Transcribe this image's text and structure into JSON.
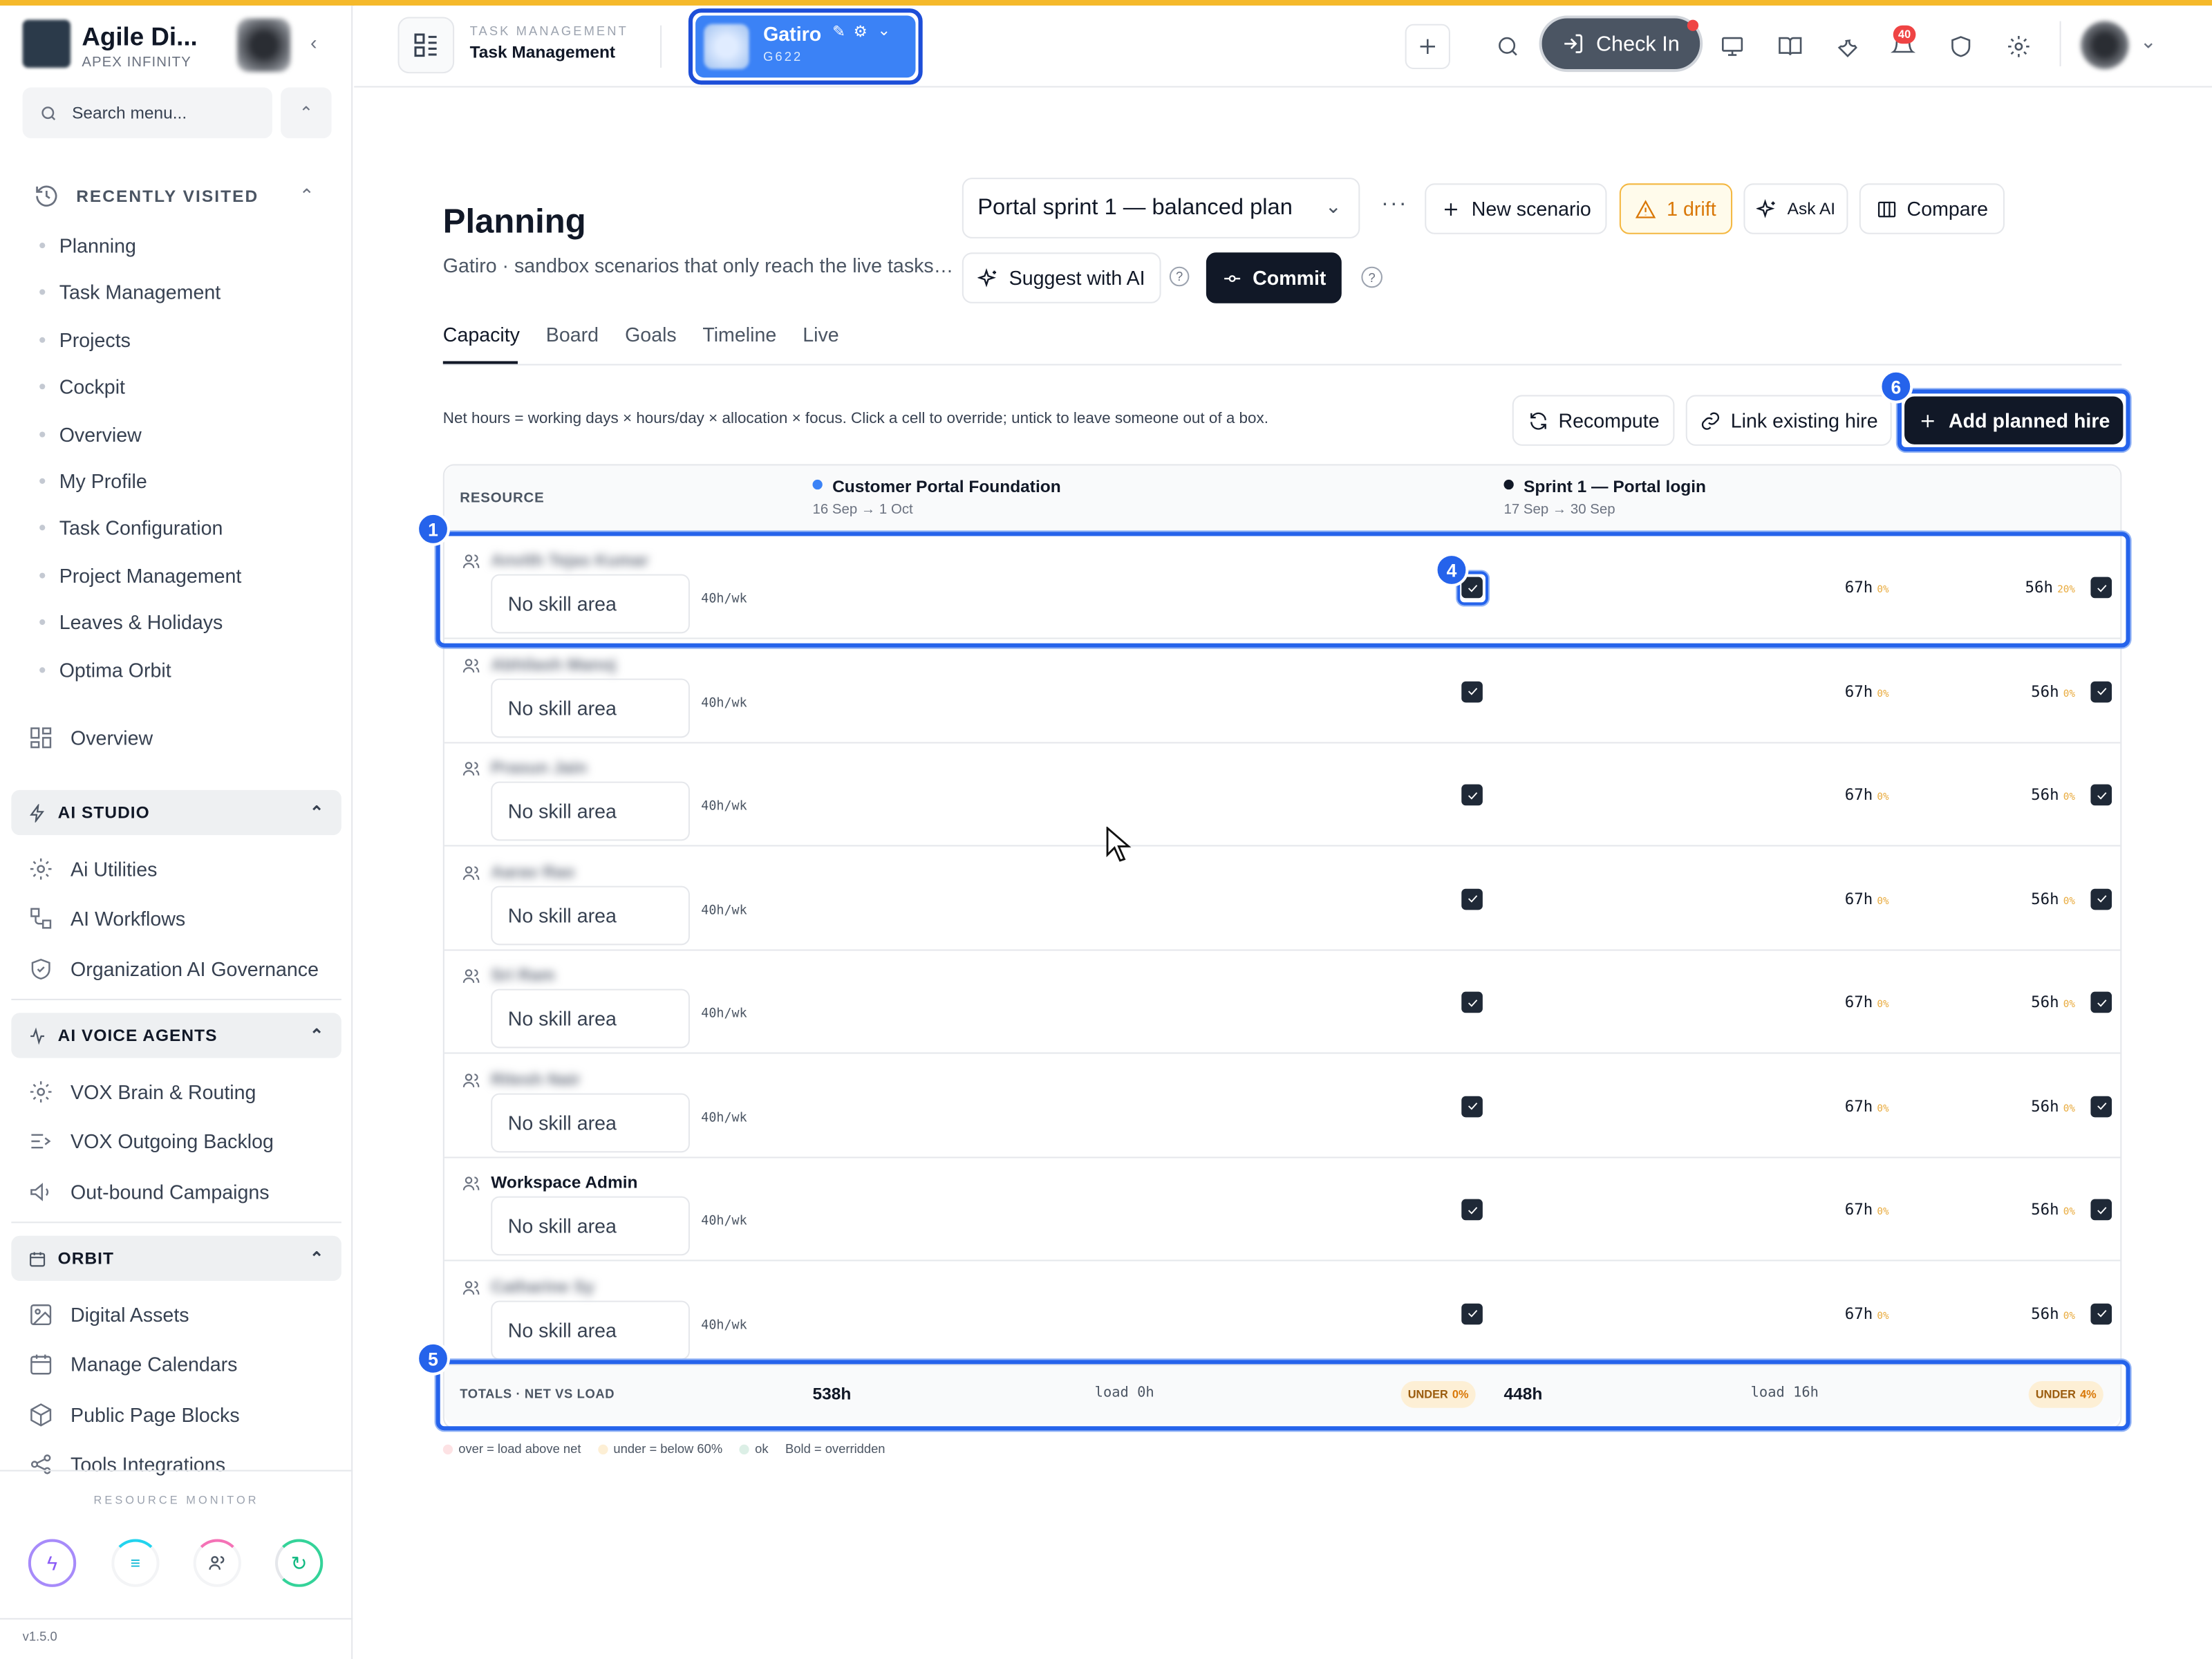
{
  "app": {
    "title": "Agile Di...",
    "org": "APEX INFINITY",
    "version": "v1.5.0"
  },
  "sidebar": {
    "search_placeholder": "Search menu...",
    "recent_label": "RECENTLY VISITED",
    "recent_items": [
      "Planning",
      "Task Management",
      "Projects",
      "Cockpit",
      "Overview",
      "My Profile",
      "Task Configuration",
      "Project Management",
      "Leaves & Holidays",
      "Optima Orbit"
    ],
    "overview_label": "Overview",
    "sections": [
      {
        "label": "AI STUDIO",
        "items": [
          "Ai Utilities",
          "AI Workflows",
          "Organization AI Governance"
        ]
      },
      {
        "label": "AI VOICE AGENTS",
        "items": [
          "VOX Brain & Routing",
          "VOX Outgoing Backlog",
          "Out-bound Campaigns"
        ]
      },
      {
        "label": "ORBIT",
        "items": [
          "Digital Assets",
          "Manage Calendars",
          "Public Page Blocks",
          "Tools Integrations"
        ]
      }
    ],
    "resource_monitor": "RESOURCE MONITOR"
  },
  "header": {
    "module_label": "TASK MANAGEMENT",
    "module_title": "Task Management",
    "workspace_name": "Gatiro",
    "workspace_code": "G622",
    "check_in": "Check In",
    "notif_count": "40"
  },
  "page": {
    "title": "Planning",
    "subtitle": "Gatiro · sandbox scenarios that only reach the live tasks…",
    "scenario": "Portal sprint 1 — balanced plan",
    "new_scenario": "New scenario",
    "drift": "1 drift",
    "ask_ai": "Ask AI",
    "compare": "Compare",
    "suggest_ai": "Suggest with AI",
    "commit": "Commit",
    "tabs": [
      "Capacity",
      "Board",
      "Goals",
      "Timeline",
      "Live"
    ],
    "help_text": "Net hours = working days × hours/day × allocation × focus. Click a cell to override; untick to leave someone out of a box.",
    "recompute": "Recompute",
    "link_hire": "Link existing hire",
    "add_hire": "Add planned hire"
  },
  "table": {
    "resource_header": "RESOURCE",
    "columns": [
      {
        "name": "Customer Portal Foundation",
        "dates": "16 Sep → 1 Oct",
        "dot_color": "#3b82f6"
      },
      {
        "name": "Sprint 1 — Portal login",
        "dates": "17 Sep → 30 Sep",
        "dot_color": "#111827"
      }
    ],
    "rows": [
      {
        "name": "Anvith Tejas Kumar",
        "blurred": true,
        "skill": "No skill area",
        "weekly": "40h/wk",
        "c1_hours": "67h",
        "c1_pct": "0%",
        "c2_hours": "56h",
        "c2_pct": "20%"
      },
      {
        "name": "Abhilash Manoj",
        "blurred": true,
        "skill": "No skill area",
        "weekly": "40h/wk",
        "c1_hours": "67h",
        "c1_pct": "0%",
        "c2_hours": "56h",
        "c2_pct": "0%"
      },
      {
        "name": "Prasun Jain",
        "blurred": true,
        "skill": "No skill area",
        "weekly": "40h/wk",
        "c1_hours": "67h",
        "c1_pct": "0%",
        "c2_hours": "56h",
        "c2_pct": "0%"
      },
      {
        "name": "Aarav Rao",
        "blurred": true,
        "skill": "No skill area",
        "weekly": "40h/wk",
        "c1_hours": "67h",
        "c1_pct": "0%",
        "c2_hours": "56h",
        "c2_pct": "0%"
      },
      {
        "name": "Sri Ram",
        "blurred": true,
        "skill": "No skill area",
        "weekly": "40h/wk",
        "c1_hours": "67h",
        "c1_pct": "0%",
        "c2_hours": "56h",
        "c2_pct": "0%"
      },
      {
        "name": "Ritesh Nair",
        "blurred": true,
        "skill": "No skill area",
        "weekly": "40h/wk",
        "c1_hours": "67h",
        "c1_pct": "0%",
        "c2_hours": "56h",
        "c2_pct": "0%"
      },
      {
        "name": "Workspace Admin",
        "blurred": false,
        "skill": "No skill area",
        "weekly": "40h/wk",
        "c1_hours": "67h",
        "c1_pct": "0%",
        "c2_hours": "56h",
        "c2_pct": "0%"
      },
      {
        "name": "Catharine Sy",
        "blurred": true,
        "skill": "No skill area",
        "weekly": "40h/wk",
        "c1_hours": "67h",
        "c1_pct": "0%",
        "c2_hours": "56h",
        "c2_pct": "0%"
      }
    ],
    "totals": {
      "label": "TOTALS · NET VS LOAD",
      "c1_net": "538h",
      "c1_load": "load 0h",
      "c1_badge": "UNDER",
      "c1_badge_pct": "0%",
      "c2_net": "448h",
      "c2_load": "load 16h",
      "c2_badge": "UNDER",
      "c2_badge_pct": "4%"
    },
    "legend": [
      "over = load above net",
      "under = below 60%",
      "ok",
      "Bold = overridden"
    ]
  },
  "annotations": [
    "1",
    "4",
    "5",
    "6"
  ],
  "colors": {
    "accent": "#2563eb",
    "brand_bar": "#f5b92b",
    "dark": "#111827"
  }
}
